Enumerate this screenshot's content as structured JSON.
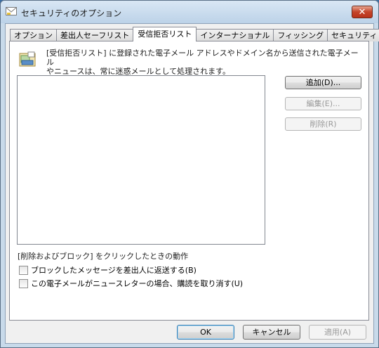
{
  "window": {
    "title": "セキュリティのオプション",
    "close_label": "✕"
  },
  "tabs": [
    {
      "label": "オプション",
      "active": false
    },
    {
      "label": "差出人セーフリスト",
      "active": false
    },
    {
      "label": "受信拒否リスト",
      "active": true
    },
    {
      "label": "インターナショナル",
      "active": false
    },
    {
      "label": "フィッシング",
      "active": false
    },
    {
      "label": "セキュリティ",
      "active": false
    }
  ],
  "panel": {
    "description_line1": "[受信拒否リスト] に登録された電子メール アドレスやドメイン名から送信された電子メール",
    "description_line2": "やニュースは、常に迷惑メールとして処理されます。",
    "buttons": {
      "add": "追加(D)...",
      "edit": "編集(E)...",
      "delete": "削除(R)"
    },
    "action_label": "[削除およびブロック] をクリックしたときの動作",
    "checkbox_return": "ブロックしたメッセージを差出人に返送する(B)",
    "checkbox_unsubscribe": "この電子メールがニュースレターの場合、購読を取り消す(U)"
  },
  "footer": {
    "ok": "OK",
    "cancel": "キャンセル",
    "apply": "適用(A)"
  }
}
